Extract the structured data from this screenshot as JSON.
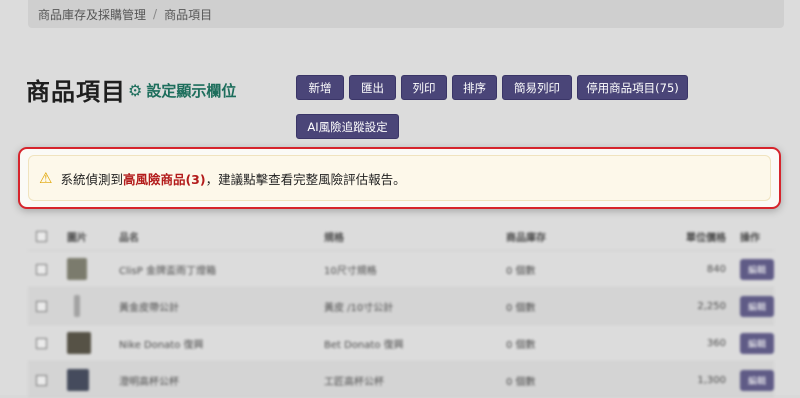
{
  "breadcrumb": {
    "parent": "商品庫存及採購管理",
    "separator": "/",
    "current": "商品項目"
  },
  "header": {
    "title": "商品項目",
    "settings_label": "設定顯示欄位"
  },
  "toolbar": {
    "buttons": [
      "新增",
      "匯出",
      "列印",
      "排序",
      "簡易列印",
      "停用商品項目(75)",
      "AI風險追蹤設定"
    ]
  },
  "alert": {
    "prefix": "系統偵測到",
    "risk_link": "高風險商品(3)",
    "suffix": "，建議點擊查看完整風險評估報告。"
  },
  "table": {
    "headers": [
      "圖片",
      "品名",
      "規格",
      "商品庫存",
      "單位價格",
      "操作"
    ],
    "rows": [
      {
        "name": "ClisP 金牌盃雨丁燈箱",
        "spec": "10尺寸規格",
        "stock": "0 個數",
        "price": "840",
        "action": "編輯"
      },
      {
        "name": "黃金皮帶公計",
        "spec": "黃皮 /10寸公計",
        "stock": "0 個數",
        "price": "2,250",
        "action": "編輯"
      },
      {
        "name": "Nike Donato 復興",
        "spec": "Bet Donato 復興",
        "stock": "0 個數",
        "price": "360",
        "action": "編輯"
      },
      {
        "name": "澄明高杯公杯",
        "spec": "工匠高杯公杯",
        "stock": "0 個數",
        "price": "1,300",
        "action": "編輯"
      }
    ]
  },
  "colors": {
    "accent": "#4a4578",
    "link_green": "#1d6e5c",
    "risk_red": "#b31b1b",
    "border_red": "#d6242c"
  }
}
